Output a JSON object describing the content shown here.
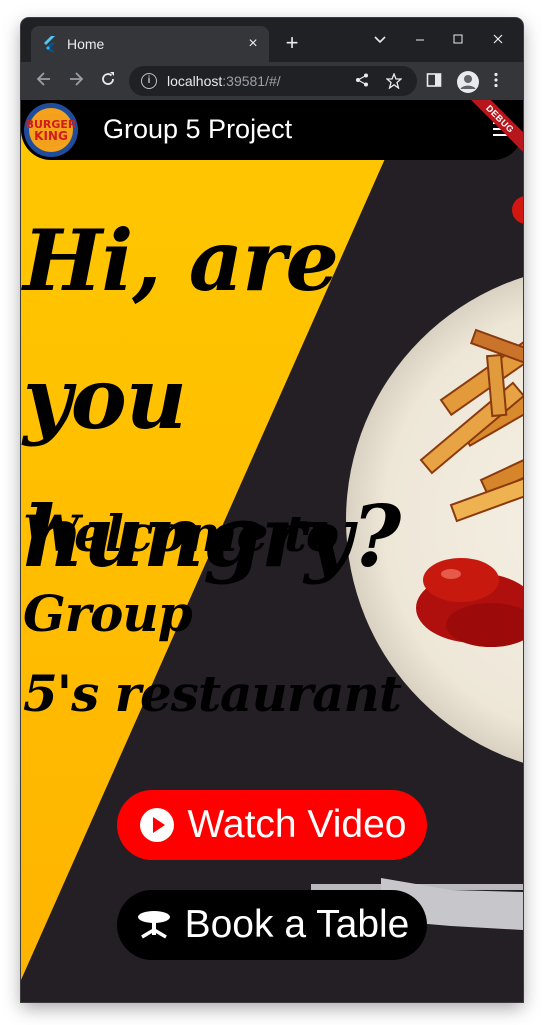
{
  "browser": {
    "tab_title": "Home",
    "tab_close_glyph": "×",
    "new_tab_glyph": "+",
    "url_host": "localhost",
    "url_rest": ":39581/#/",
    "icons": [
      "flutter-favicon",
      "back-arrow-icon",
      "forward-arrow-icon",
      "reload-icon",
      "site-info-icon",
      "share-icon",
      "star-icon",
      "side-panel-icon",
      "profile-icon",
      "kebab-menu-icon",
      "chevron-down-icon",
      "minimize-icon",
      "maximize-icon",
      "close-window-icon"
    ]
  },
  "app": {
    "title": "Group 5 Project",
    "debug_label": "DEBUG",
    "logo_text_top": "BURGER",
    "logo_text_bottom": "KING",
    "headline_line1": "Hi, are you",
    "headline_line2": "hungry?",
    "subline_line1": "Welcome to Group",
    "subline_line2": "5's restaurant",
    "watch_video_label": "Watch Video",
    "book_table_label": "Book a Table",
    "colors": {
      "appbar": "#000000",
      "watch_button": "#ff0000",
      "book_button": "#000000",
      "yellow_background": "#ffc400",
      "dark_background": "#231f24"
    }
  }
}
